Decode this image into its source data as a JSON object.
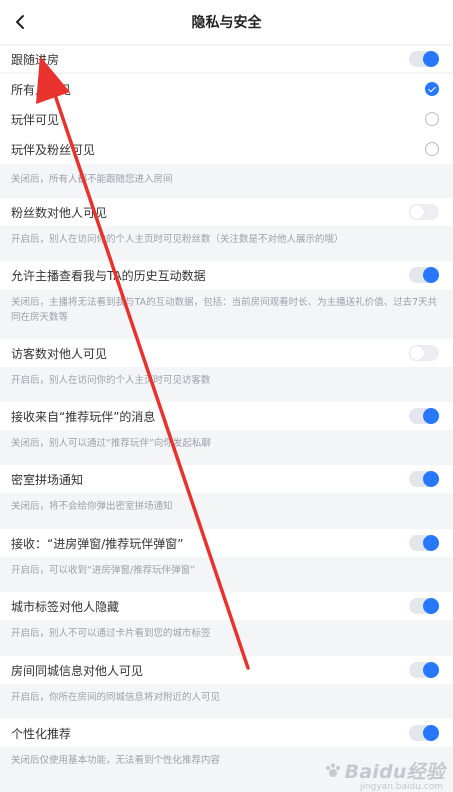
{
  "header": {
    "title": "隐私与安全",
    "back_icon": "chevron-left-icon"
  },
  "follow_section": {
    "toggle_label": "跟随进房",
    "toggle_on": true,
    "options": [
      {
        "label": "所有人可见",
        "checked": true
      },
      {
        "label": "玩伴可见",
        "checked": false
      },
      {
        "label": "玩伴及粉丝可见",
        "checked": false
      }
    ],
    "note": "关闭后，所有人都不能跟随您进入房间"
  },
  "settings": [
    {
      "label": "粉丝数对他人可见",
      "on": false,
      "note": "开启后，别人在访问你的个人主页时可见粉丝数（关注数是不对他人展示的哦）"
    },
    {
      "label": "允许主播查看我与TA的历史互动数据",
      "on": true,
      "note": "关闭后，主播将无法看到我与TA的互动数据，包括：当前房间观看时长、为主播送礼价值、过去7天共同在房天数等"
    },
    {
      "label": "访客数对他人可见",
      "on": false,
      "note": "开启后，别人在访问你的个人主页时可见访客数"
    },
    {
      "label": "接收来自“推荐玩伴”的消息",
      "on": true,
      "note": "关闭后，别人可以通过“推荐玩伴”向你发起私聊"
    },
    {
      "label": "密室拼场通知",
      "on": true,
      "note": "关闭后，将不会给你弹出密室拼场通知"
    },
    {
      "label": "接收：“进房弹窗/推荐玩伴弹窗”",
      "on": true,
      "note": "开启后，可以收到“进房弹窗/推荐玩伴弹窗”"
    },
    {
      "label": "城市标签对他人隐藏",
      "on": true,
      "note": "开启后，别人不可以通过卡片看到您的城市标签"
    },
    {
      "label": "房间同城信息对他人可见",
      "on": true,
      "note": "开启后，你所在房间的同城信息将对附近的人可见"
    },
    {
      "label": "个性化推荐",
      "on": true,
      "note": "关闭后仅使用基本功能，无法看到个性化推荐内容"
    }
  ],
  "colors": {
    "accent": "#2878ff",
    "annotation_arrow": "#e8322d"
  },
  "watermark": {
    "brand": "Baidu经验",
    "url": "jingyan.baidu.com"
  }
}
